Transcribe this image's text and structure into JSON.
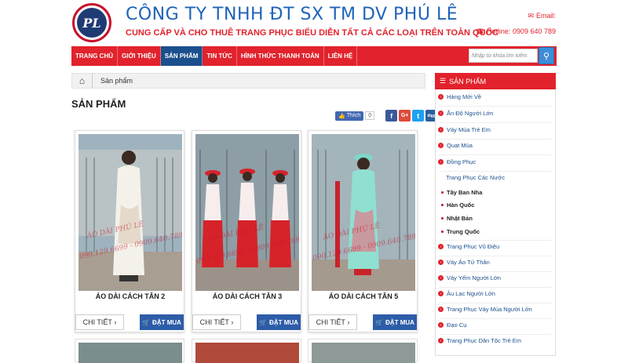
{
  "header": {
    "company_name": "CÔNG TY TNHH ĐT SX TM DV PHÚ LÊ",
    "slogan": "CUNG CẤP VÀ CHO THUÊ TRANG PHỤC BIỂU DIỄN TẤT CẢ CÁC LOẠI TRÊN TOÀN QUỐC",
    "email_label": "Email:",
    "hotline": "Hotline: 0909 640 789",
    "logo_text": "PL"
  },
  "nav": {
    "items": [
      "TRANG CHỦ",
      "GIỚI THIỆU",
      "SẢN PHẨM",
      "TIN TỨC",
      "HÌNH THỨC THANH TOÁN",
      "LIÊN HỆ"
    ],
    "active_index": 2,
    "search_placeholder": "Nhập từ khóa tìm kiếm"
  },
  "breadcrumb": {
    "current": "Sản phẩm"
  },
  "page_title": "SẢN PHẨM",
  "social": {
    "like_label": "Thích",
    "like_count": "0",
    "buttons": [
      "f",
      "G+",
      "t",
      "digg"
    ]
  },
  "products": [
    {
      "name": "ÁO DÀI CÁCH TÂN 2",
      "detail_label": "CHI TIẾT",
      "order_label": "ĐẶT MUA"
    },
    {
      "name": "ÁO DÀI CÁCH TÂN 3",
      "detail_label": "CHI TIẾT",
      "order_label": "ĐẶT MUA"
    },
    {
      "name": "ÁO DÀI CÁCH TÂN 5",
      "detail_label": "CHI TIẾT",
      "order_label": "ĐẶT MUA"
    }
  ],
  "watermark": {
    "shop": "ÁO DÀI PHÚ LÊ",
    "phones": "090.129.6699 - 0909.640.789"
  },
  "sidebar": {
    "title": "SẢN PHẨM",
    "items": [
      {
        "label": "Hàng Mới Về",
        "level": 0
      },
      {
        "label": "Ấn Độ Người Lớn",
        "level": 0
      },
      {
        "label": "Váy Múa Trẻ Em",
        "level": 0
      },
      {
        "label": "Quạt Múa",
        "level": 0
      },
      {
        "label": "Đồng Phục",
        "level": 0
      },
      {
        "label": "Trang Phục Các Nước",
        "level": 2
      },
      {
        "label": "Tây Ban Nha",
        "level": 1
      },
      {
        "label": "Hàn Quốc",
        "level": 1
      },
      {
        "label": "Nhật Bản",
        "level": 1
      },
      {
        "label": "Trung Quốc",
        "level": 1
      },
      {
        "label": "Trang Phục Vũ Điệu",
        "level": 0
      },
      {
        "label": "Váy Áo Tứ Thân",
        "level": 0
      },
      {
        "label": "Váy Yếm Người Lớn",
        "level": 0
      },
      {
        "label": "Âu Lạc Người Lớn",
        "level": 0
      },
      {
        "label": "Trang Phục Váy Múa Người Lớn",
        "level": 0
      },
      {
        "label": "Đạo Cụ",
        "level": 0
      },
      {
        "label": "Trang Phục Dân Tộc Trẻ Em",
        "level": 0
      }
    ]
  },
  "colors": {
    "brand_red": "#e2222c",
    "brand_blue": "#1b4f8c",
    "title_blue": "#1e63b8"
  }
}
